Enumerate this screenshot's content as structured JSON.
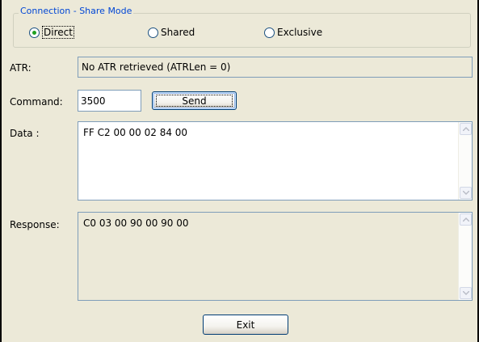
{
  "connection_group": {
    "title": "Connection - Share Mode",
    "options": [
      {
        "label": "Direct",
        "selected": true
      },
      {
        "label": "Shared",
        "selected": false
      },
      {
        "label": "Exclusive",
        "selected": false
      }
    ]
  },
  "atr": {
    "label": "ATR:",
    "value": "No ATR retrieved (ATRLen = 0)"
  },
  "command": {
    "label": "Command:",
    "value": "3500",
    "send_label": "Send"
  },
  "data_field": {
    "label": "Data :",
    "value": "FF C2 00 00 02 84 00"
  },
  "response_field": {
    "label": "Response:",
    "value": "C0 03 00 90 00 90 00"
  },
  "exit_label": "Exit",
  "icons": {
    "scroll_up": "scroll-up-arrow-icon",
    "scroll_down": "scroll-down-arrow-icon"
  },
  "colors": {
    "dialog_background": "#ece9d8",
    "groupbox_title": "#0046d5",
    "field_border": "#7f9db9",
    "radio_dot": "#21a121",
    "button_border": "#003c74"
  }
}
